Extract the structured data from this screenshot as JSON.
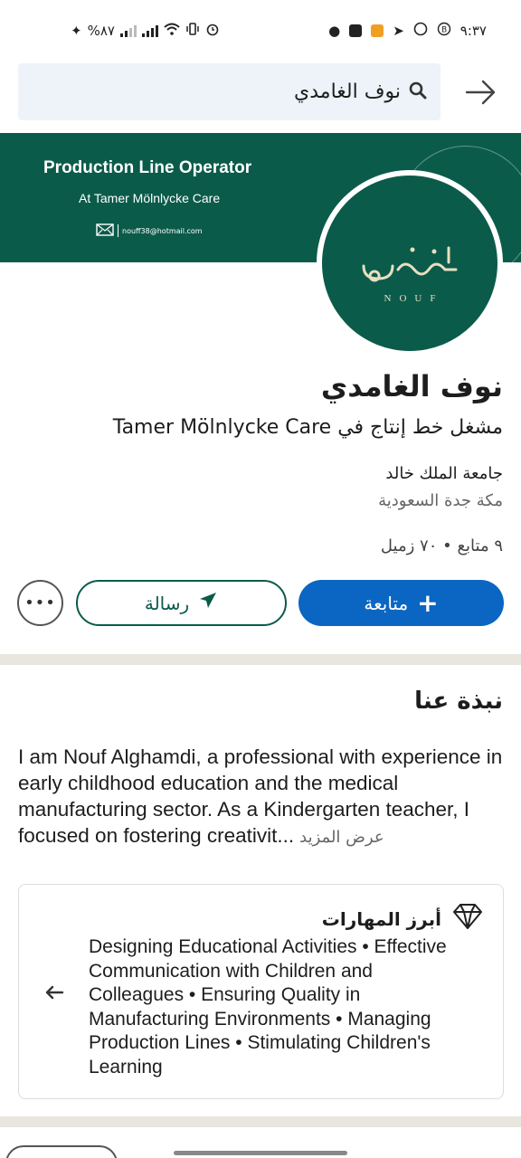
{
  "status_bar": {
    "time": "٩:٣٧",
    "battery": "%٨٧"
  },
  "search": {
    "query": "نوف الغامدي"
  },
  "banner": {
    "title": "Production Line Operator",
    "subtitle": "At Tamer Mölnlycke Care",
    "email": "nouff38@hotmail.com"
  },
  "avatar": {
    "brand_word": "NOUF"
  },
  "profile": {
    "name": "نوف الغامدي",
    "headline": "مشغل خط إنتاج في Tamer Mölnlycke Care",
    "school": "جامعة الملك خالد",
    "location": "مكة جدة السعودية",
    "stats": "٩ متابع • ٧٠ زميل"
  },
  "actions": {
    "follow_label": "متابعة",
    "message_label": "رسالة",
    "more_label": "•••"
  },
  "about": {
    "title": "نبذة عنا",
    "text": "I am Nouf Alghamdi, a professional with experience in early childhood education and the medical manufacturing sector. As a Kindergarten teacher, I focused on fostering creativit...",
    "see_more": "عرض المزيد"
  },
  "skills": {
    "title": "أبرز المهارات",
    "text": "Designing Educational Activities • Effective Communication with Children and Colleagues • Ensuring Quality in Manufacturing Environments • Managing Production Lines • Stimulating Children's Learning"
  },
  "colors": {
    "brand_green": "#0b5b4b",
    "follow_blue": "#0a66c2",
    "search_bg": "#edf3f8",
    "divider": "#e9e5df"
  }
}
